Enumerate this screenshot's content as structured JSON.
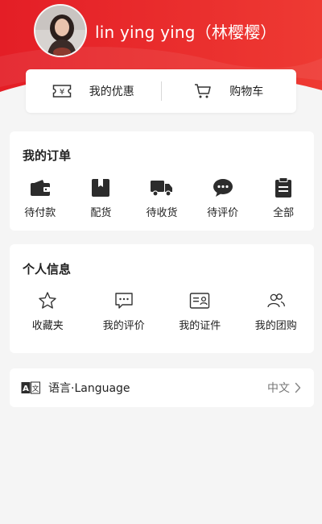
{
  "profile": {
    "username": "lin ying ying（林樱樱）"
  },
  "quick_links": [
    {
      "label": "我的优惠",
      "icon": "coupon-icon"
    },
    {
      "label": "购物车",
      "icon": "cart-icon"
    }
  ],
  "orders": {
    "title": "我的订单",
    "items": [
      {
        "label": "待付款",
        "icon": "wallet-icon"
      },
      {
        "label": "配货",
        "icon": "package-icon"
      },
      {
        "label": "待收货",
        "icon": "truck-icon"
      },
      {
        "label": "待评价",
        "icon": "chat-bubble-icon"
      },
      {
        "label": "全部",
        "icon": "clipboard-icon"
      }
    ]
  },
  "personal": {
    "title": "个人信息",
    "items": [
      {
        "label": "收藏夹",
        "icon": "star-icon"
      },
      {
        "label": "我的评价",
        "icon": "comment-icon"
      },
      {
        "label": "我的证件",
        "icon": "id-card-icon"
      },
      {
        "label": "我的团购",
        "icon": "group-icon"
      }
    ]
  },
  "language": {
    "label": "语言·Language",
    "value": "中文",
    "icon": "translate-icon"
  },
  "colors": {
    "header_red": "#e8262a",
    "background": "#f5f5f5"
  }
}
